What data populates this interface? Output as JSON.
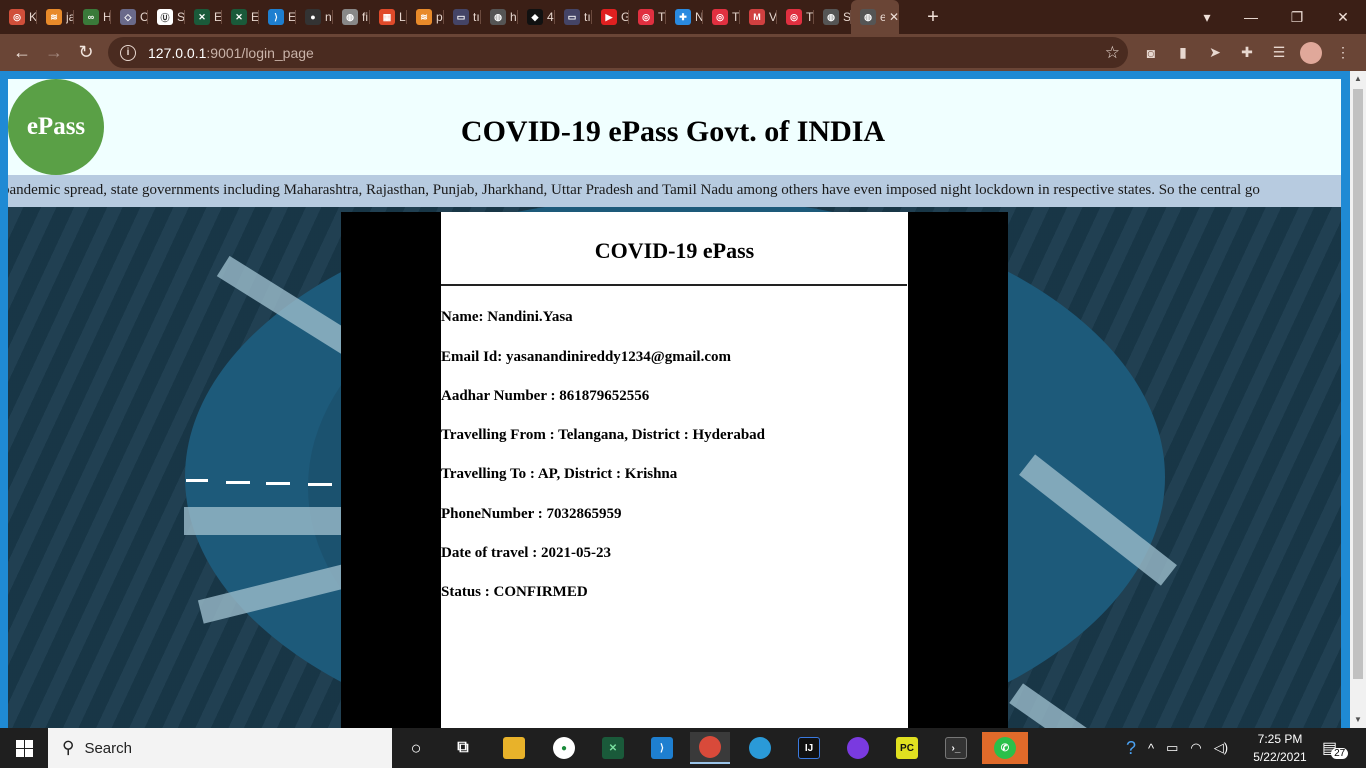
{
  "browser": {
    "tabs": [
      {
        "label": "K",
        "color": "#d04f3a",
        "glyph": "◎"
      },
      {
        "label": "ja",
        "color": "#e88a2a",
        "glyph": "≋"
      },
      {
        "label": "H",
        "color": "#3a7a3a",
        "glyph": "∞"
      },
      {
        "label": "C",
        "color": "#6a6a8a",
        "glyph": "◇"
      },
      {
        "label": "S",
        "color": "#ffffff",
        "glyph": "Ⓤ"
      },
      {
        "label": "E",
        "color": "#1a5a3a",
        "glyph": "✕"
      },
      {
        "label": "E",
        "color": "#1a5a3a",
        "glyph": "✕"
      },
      {
        "label": "E",
        "color": "#1e7fd0",
        "glyph": "⟩"
      },
      {
        "label": "n",
        "color": "#333333",
        "glyph": "●"
      },
      {
        "label": "fi",
        "color": "#888888",
        "glyph": "◍"
      },
      {
        "label": "L",
        "color": "#e04a2a",
        "glyph": "▦"
      },
      {
        "label": "p",
        "color": "#e88a2a",
        "glyph": "≋"
      },
      {
        "label": "tı",
        "color": "#444466",
        "glyph": "▭"
      },
      {
        "label": "h",
        "color": "#555555",
        "glyph": "◍"
      },
      {
        "label": "4",
        "color": "#111111",
        "glyph": "◆"
      },
      {
        "label": "tı",
        "color": "#444466",
        "glyph": "▭"
      },
      {
        "label": "G",
        "color": "#e02020",
        "glyph": "▶"
      },
      {
        "label": "T",
        "color": "#e03040",
        "glyph": "◎"
      },
      {
        "label": "N",
        "color": "#2a8ae0",
        "glyph": "✚"
      },
      {
        "label": "T",
        "color": "#e03040",
        "glyph": "◎"
      },
      {
        "label": "V",
        "color": "#d04040",
        "glyph": "M"
      },
      {
        "label": "T",
        "color": "#e03040",
        "glyph": "◎"
      },
      {
        "label": "S",
        "color": "#555555",
        "glyph": "◍"
      }
    ],
    "active_tab": {
      "label": "e",
      "close": "✕"
    },
    "new_tab": "+",
    "url_host": "127.0.0.1",
    "url_rest": ":9001/login_page",
    "window_controls": {
      "minimize": "—",
      "maximize": "❐",
      "close": "✕",
      "profile_menu": "▾"
    }
  },
  "page": {
    "logo_text": "ePass",
    "title": "COVID-19 ePass Govt. of INDIA",
    "marquee": "pandemic spread, state governments including Maharashtra, Rajasthan, Punjab, Jharkhand, Uttar Pradesh and Tamil Nadu among others have even imposed night lockdown in respective states. So the central go",
    "card": {
      "heading": "COVID-19 ePass",
      "fields": [
        "Name: Nandini.Yasa",
        "Email Id: yasanandinireddy1234@gmail.com",
        "Aadhar Number : 861879652556",
        "Travelling From : Telangana, District : Hyderabad",
        "Travelling To : AP, District : Krishna",
        "PhoneNumber : 7032865959",
        "Date of travel : 2021-05-23",
        "Status : CONFIRMED"
      ]
    }
  },
  "taskbar": {
    "search_placeholder": "Search",
    "time": "7:25 PM",
    "date": "5/22/2021",
    "notification_count": "27"
  }
}
